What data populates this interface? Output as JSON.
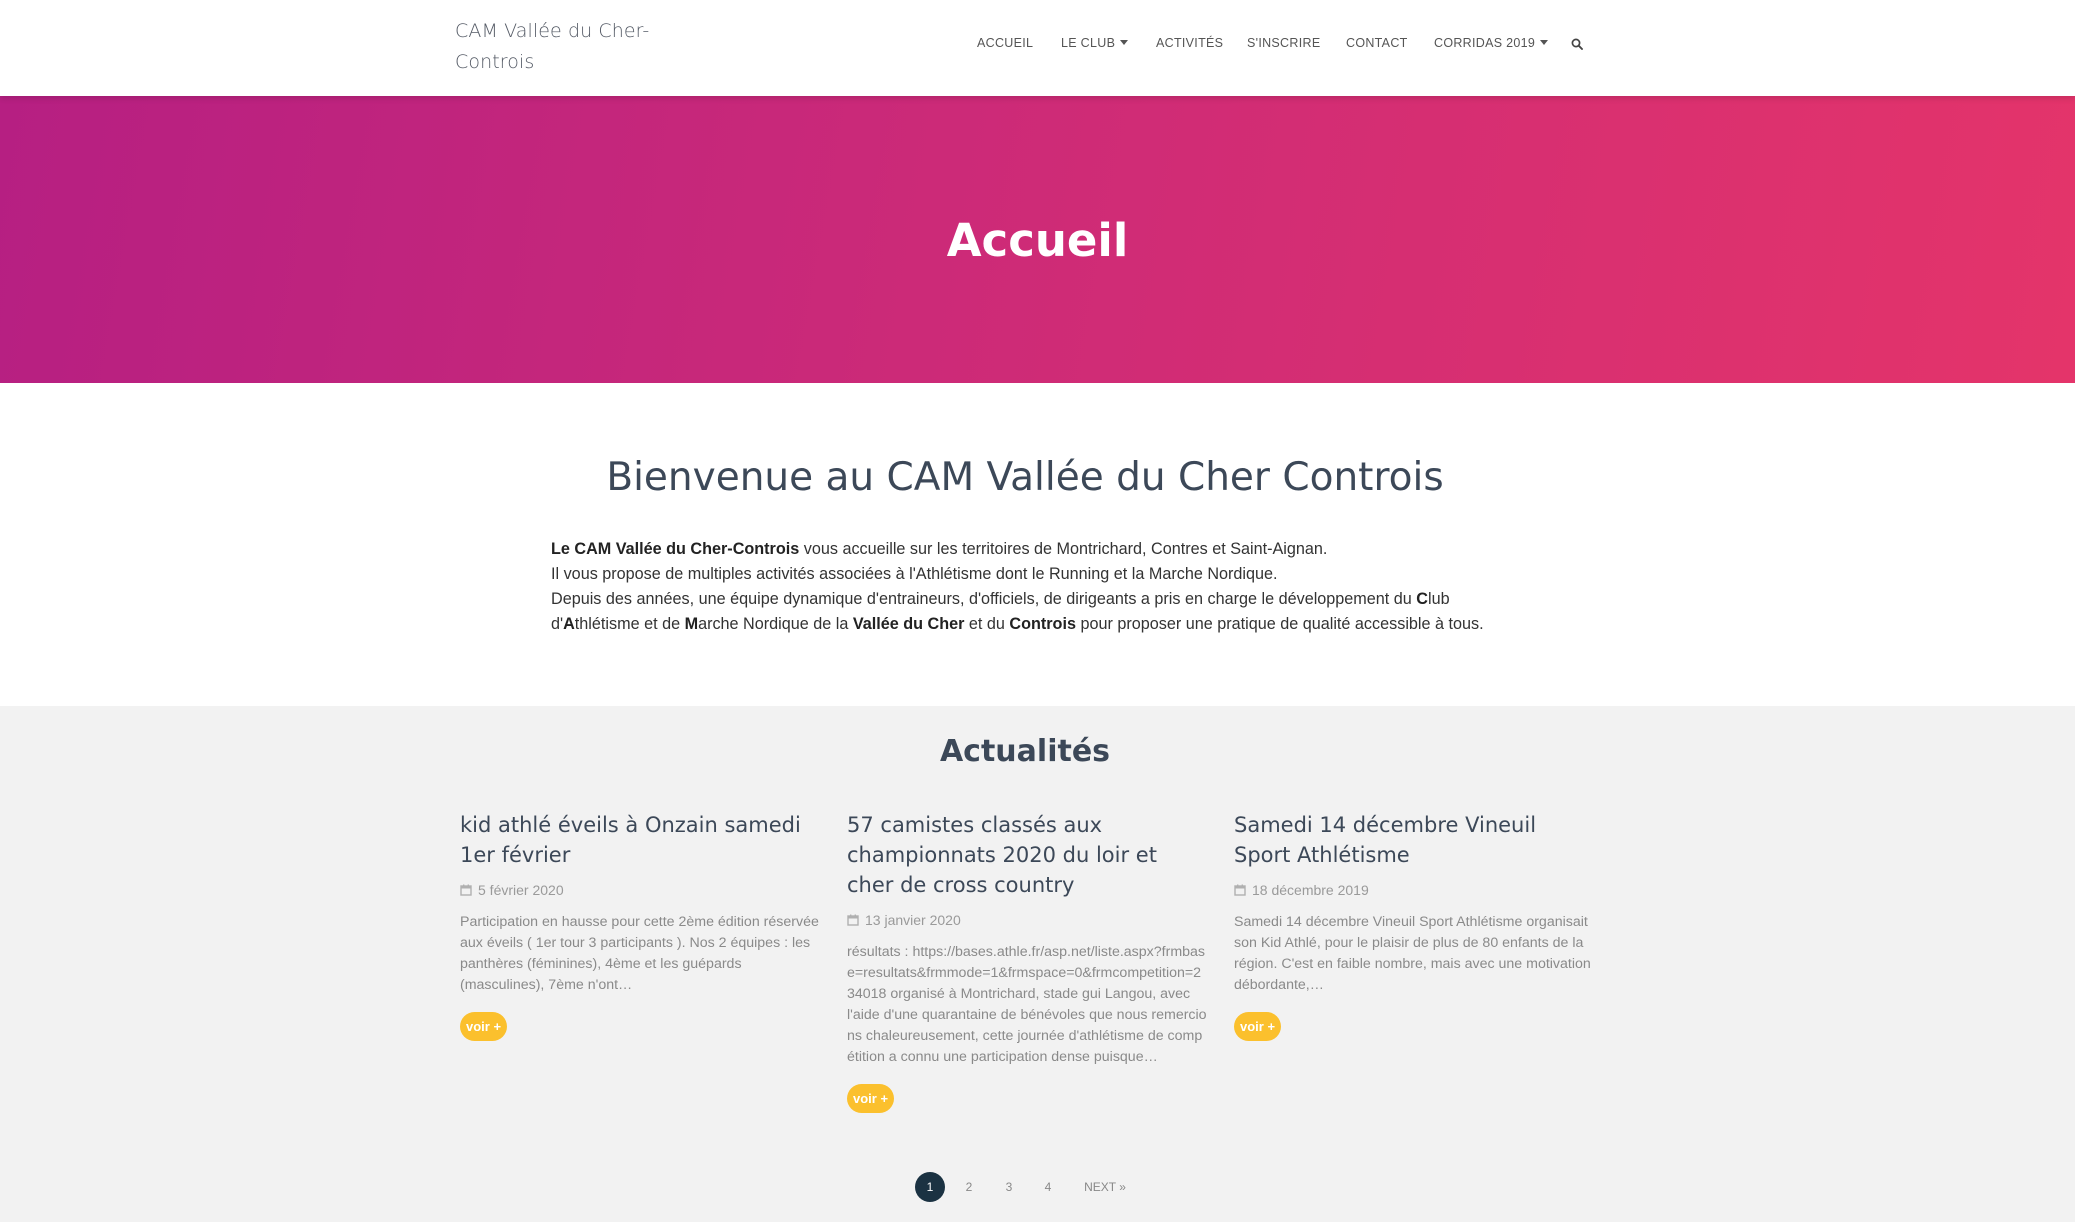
{
  "brand": {
    "line1": "CAM Vallée du Cher-",
    "line2": "Controis"
  },
  "nav": {
    "items": [
      {
        "label": "ACCUEIL",
        "dropdown": false
      },
      {
        "label": "LE CLUB",
        "dropdown": true
      },
      {
        "label": "ACTIVITÉS",
        "dropdown": false
      },
      {
        "label": "S'INSCRIRE",
        "dropdown": false
      },
      {
        "label": "CONTACT",
        "dropdown": false
      },
      {
        "label": "CORRIDAS 2019",
        "dropdown": true
      }
    ],
    "search_icon": "search-icon"
  },
  "hero": {
    "title": "Accueil"
  },
  "welcome": {
    "title": "Bienvenue au CAM Vallée du Cher Controis",
    "p1_bold": "Le CAM Vallée du Cher-Controis",
    "p1_rest": " vous accueille sur les territoires de Montrichard, Contres et Saint-Aignan.",
    "p2": "Il vous propose de multiples activités associées à l'Athlétisme dont le Running et la Marche Nordique.",
    "p3_a": "Depuis des années, une équipe dynamique d'entraineurs, d'officiels, de dirigeants a pris en charge le développement du ",
    "p3_C": "C",
    "p3_b": "lub",
    "p3_c": "d'",
    "p3_A": "A",
    "p3_d": "thlétisme et de ",
    "p3_M": "M",
    "p3_e": "arche Nordique de la ",
    "p3_vallee": "Vallée du Cher",
    "p3_f": " et du ",
    "p3_controis": "Controis",
    "p3_g": " pour proposer une pratique de qualité accessible à tous."
  },
  "news": {
    "title": "Actualités",
    "cards": [
      {
        "title": "kid athlé éveils à Onzain samedi 1er février",
        "date": "5 février 2020",
        "excerpt": "Participation en hausse pour cette 2ème édition réservée aux éveils ( 1er tour 3 participants ).  Nos 2 équipes : les panthères (féminines), 4ème et les guépards (masculines), 7ème n'ont…",
        "button": "voir +"
      },
      {
        "title": "57 camistes classés aux championnats 2020 du loir et cher de cross country",
        "date": "13 janvier 2020",
        "excerpt": "résultats :   https://bases.athle.fr/asp.net/liste.aspx?frmbase=resultats&frmmode=1&frmspace=0&frmcompetition=234018 organisé à Montrichard, stade gui Langou, avec l'aide d'une quarantaine de bénévoles que nous remercions chaleureusement, cette journée d'athlétisme de compétition a connu une participation dense puisque…",
        "button": "voir +"
      },
      {
        "title": "Samedi 14 décembre Vineuil Sport Athlétisme",
        "date": "18 décembre 2019",
        "excerpt": "Samedi 14 décembre Vineuil Sport Athlétisme organisait son Kid Athlé, pour le plaisir de plus de 80 enfants de la région. C'est en faible nombre, mais avec une  motivation débordante,…",
        "button": "voir +"
      }
    ]
  },
  "pagination": {
    "pages": [
      "1",
      "2",
      "3",
      "4"
    ],
    "next": "NEXT »",
    "current": "1"
  },
  "colors": {
    "hero_start": "#b61f82",
    "hero_end": "#e4346a",
    "button": "#fbc02d",
    "active_page": "#1b3242"
  }
}
